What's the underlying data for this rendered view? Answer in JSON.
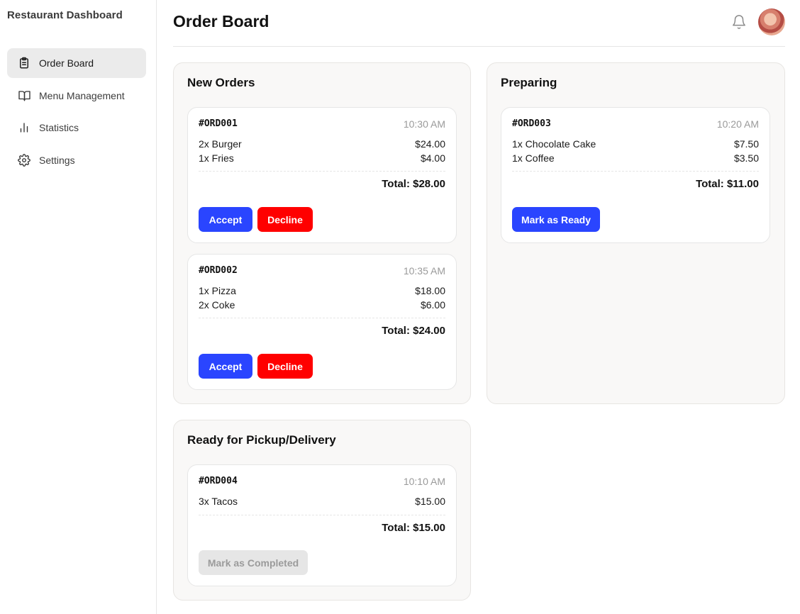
{
  "app": {
    "brand": "Restaurant Dashboard"
  },
  "sidebar": {
    "items": [
      {
        "label": "Order Board",
        "icon": "clipboard-icon",
        "active": true
      },
      {
        "label": "Menu Management",
        "icon": "book-open-icon",
        "active": false
      },
      {
        "label": "Statistics",
        "icon": "bar-chart-icon",
        "active": false
      },
      {
        "label": "Settings",
        "icon": "gear-icon",
        "active": false
      }
    ]
  },
  "header": {
    "title": "Order Board",
    "icons": [
      "bell-icon",
      "avatar"
    ]
  },
  "colors": {
    "primary": "#2a45ff",
    "danger": "#ff0000",
    "disabled_bg": "#e6e6e6",
    "disabled_text": "#9b9b9b",
    "column_bg": "#f9f8f7"
  },
  "columns": {
    "new": {
      "title": "New Orders",
      "orders": [
        {
          "id": "#ORD001",
          "time": "10:30 AM",
          "items": [
            {
              "name": "2x Burger",
              "price": "$24.00"
            },
            {
              "name": "1x Fries",
              "price": "$4.00"
            }
          ],
          "total": "Total: $28.00",
          "actions": [
            "Accept",
            "Decline"
          ]
        },
        {
          "id": "#ORD002",
          "time": "10:35 AM",
          "items": [
            {
              "name": "1x Pizza",
              "price": "$18.00"
            },
            {
              "name": "2x Coke",
              "price": "$6.00"
            }
          ],
          "total": "Total: $24.00",
          "actions": [
            "Accept",
            "Decline"
          ]
        }
      ]
    },
    "preparing": {
      "title": "Preparing",
      "orders": [
        {
          "id": "#ORD003",
          "time": "10:20 AM",
          "items": [
            {
              "name": "1x Chocolate Cake",
              "price": "$7.50"
            },
            {
              "name": "1x Coffee",
              "price": "$3.50"
            }
          ],
          "total": "Total: $11.00",
          "actions": [
            "Mark as Ready"
          ]
        }
      ]
    },
    "ready": {
      "title": "Ready for Pickup/Delivery",
      "orders": [
        {
          "id": "#ORD004",
          "time": "10:10 AM",
          "items": [
            {
              "name": "3x Tacos",
              "price": "$15.00"
            }
          ],
          "total": "Total: $15.00",
          "actions": [
            "Mark as Completed"
          ],
          "action_disabled": true
        }
      ]
    }
  }
}
